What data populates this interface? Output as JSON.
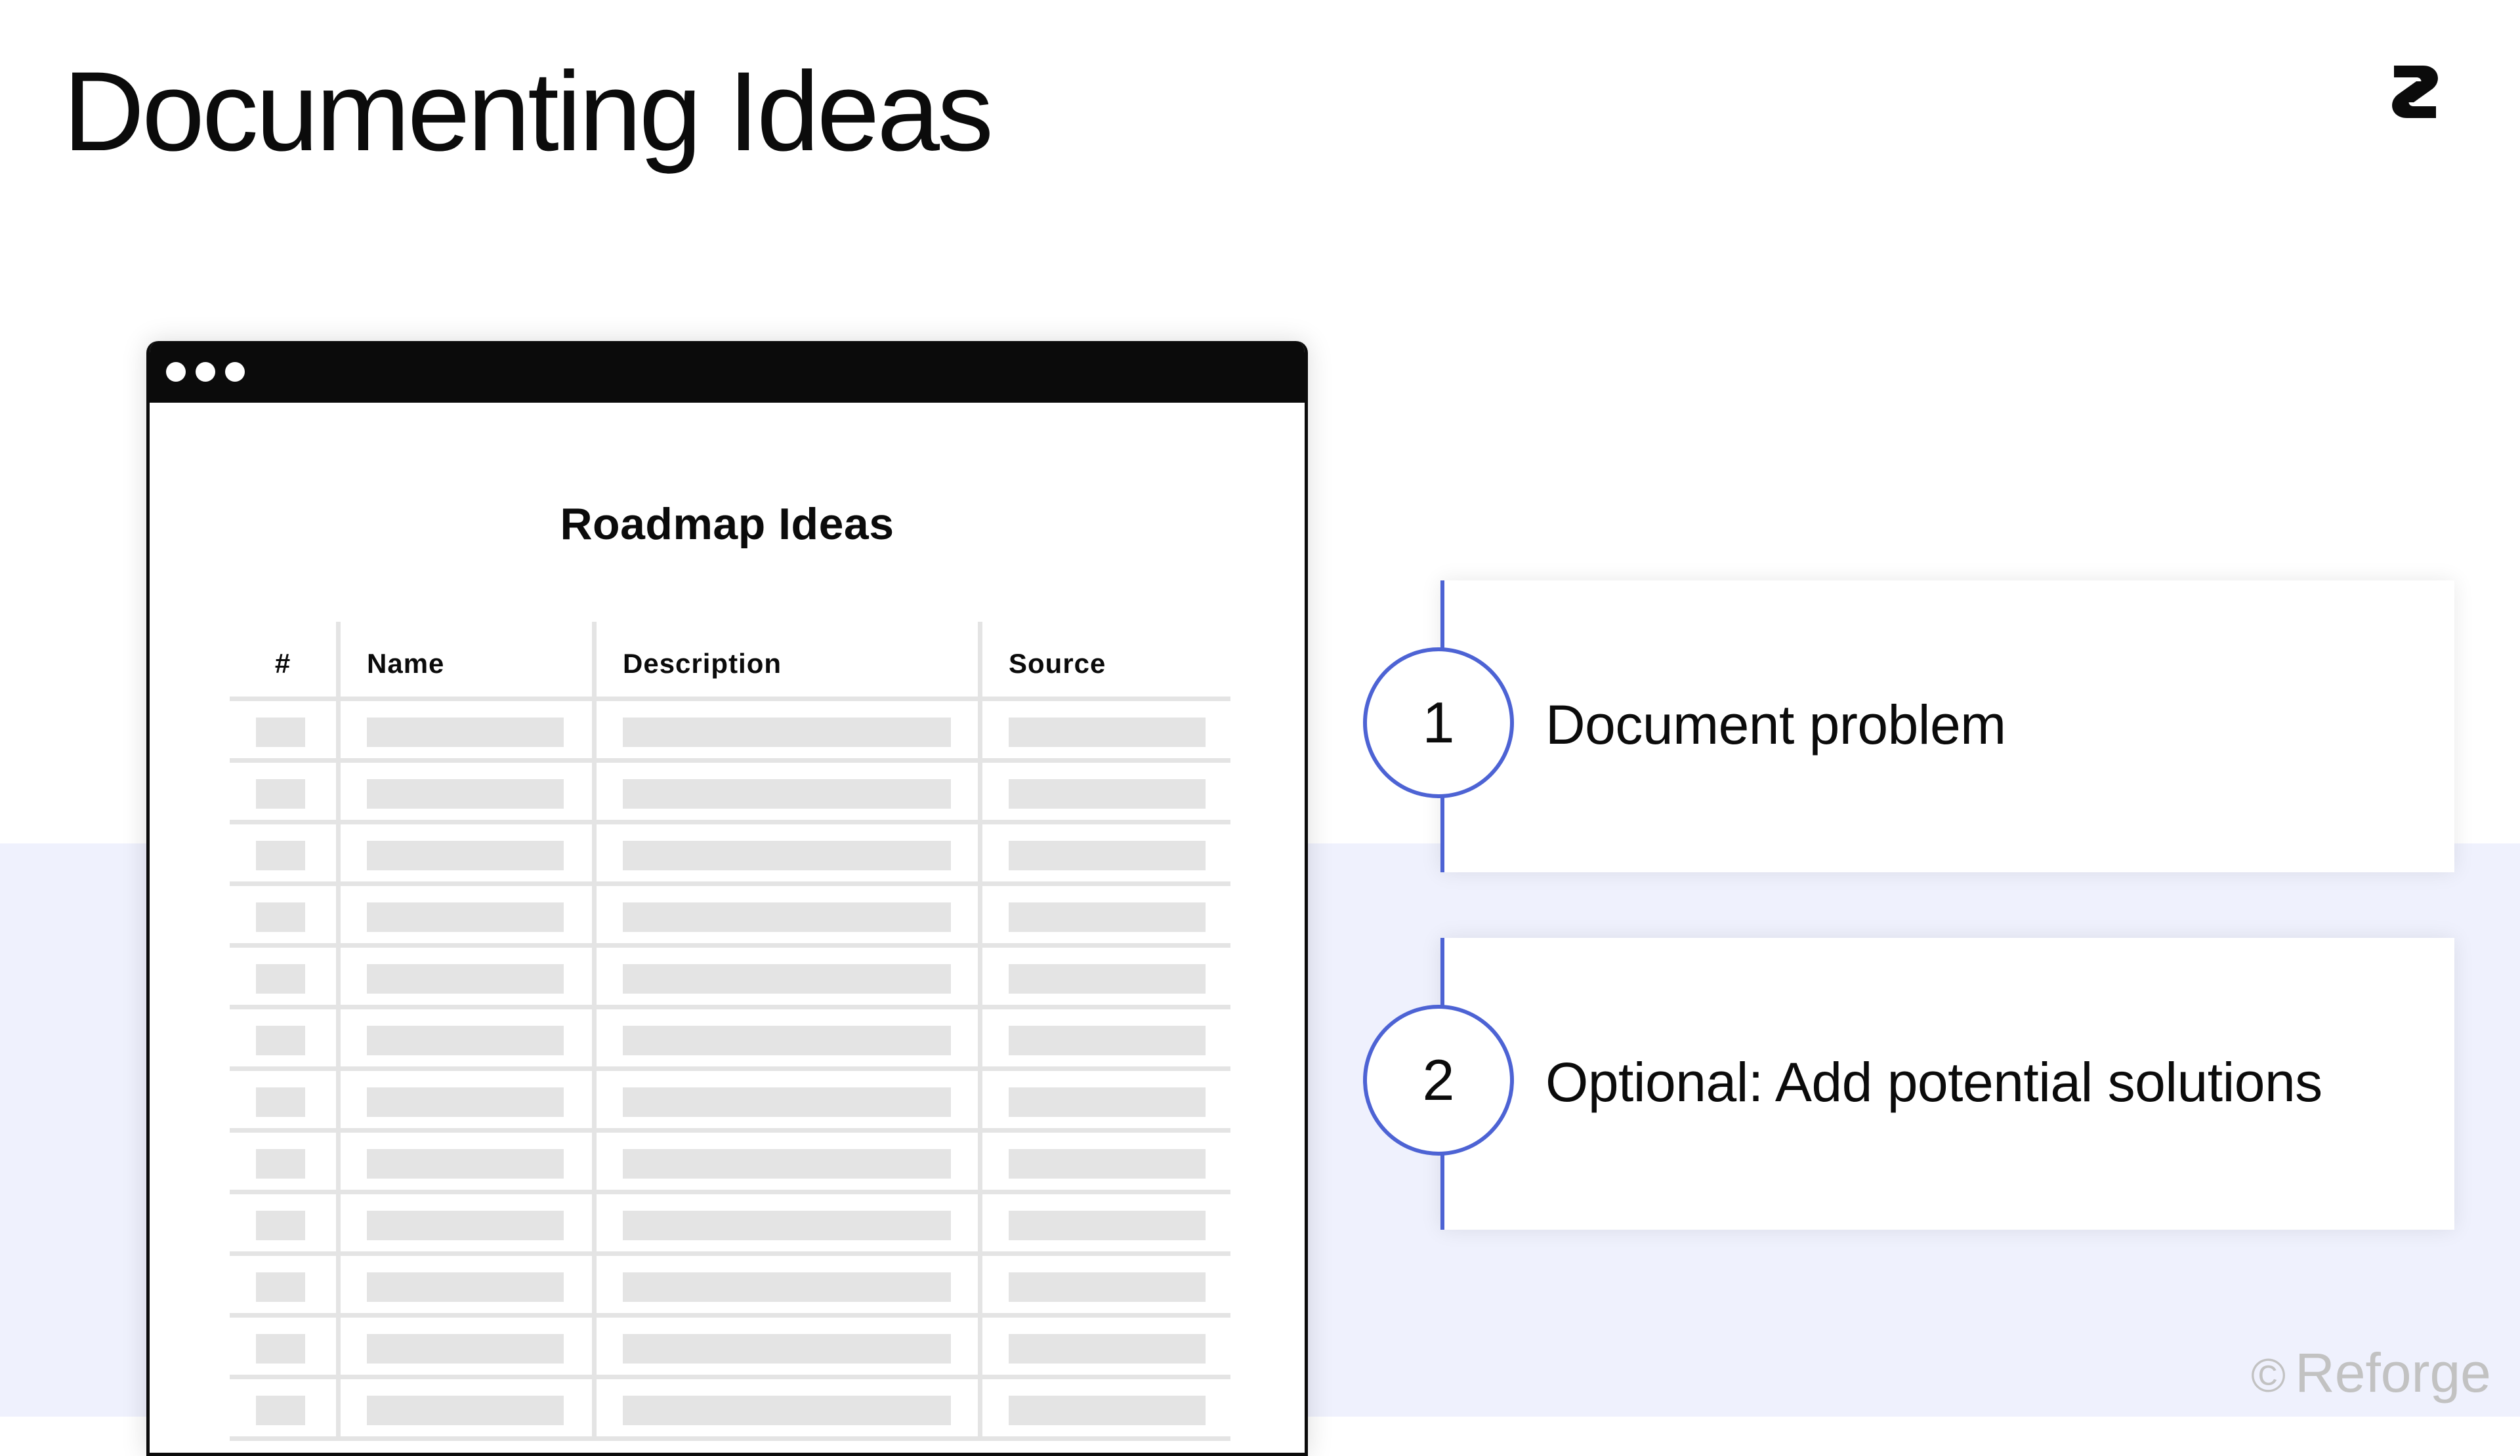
{
  "slide": {
    "title": "Documenting Ideas",
    "footer": {
      "copyright_symbol": "©",
      "brand": "Reforge"
    },
    "logo_icon": "reforge-logo-icon"
  },
  "window": {
    "title": "Roadmap Ideas",
    "table": {
      "headers": [
        "#",
        "Name",
        "Description",
        "Source"
      ],
      "placeholder_rows": 12
    }
  },
  "steps": [
    {
      "number": "1",
      "label": "Document problem"
    },
    {
      "number": "2",
      "label": "Optional: Add potential solutions"
    }
  ],
  "colors": {
    "accent": "#4d63d4",
    "band": "#eff1fd",
    "placeholder": "#e4e4e4",
    "text": "#0b0b0b",
    "footer": "#c2c2c2"
  }
}
